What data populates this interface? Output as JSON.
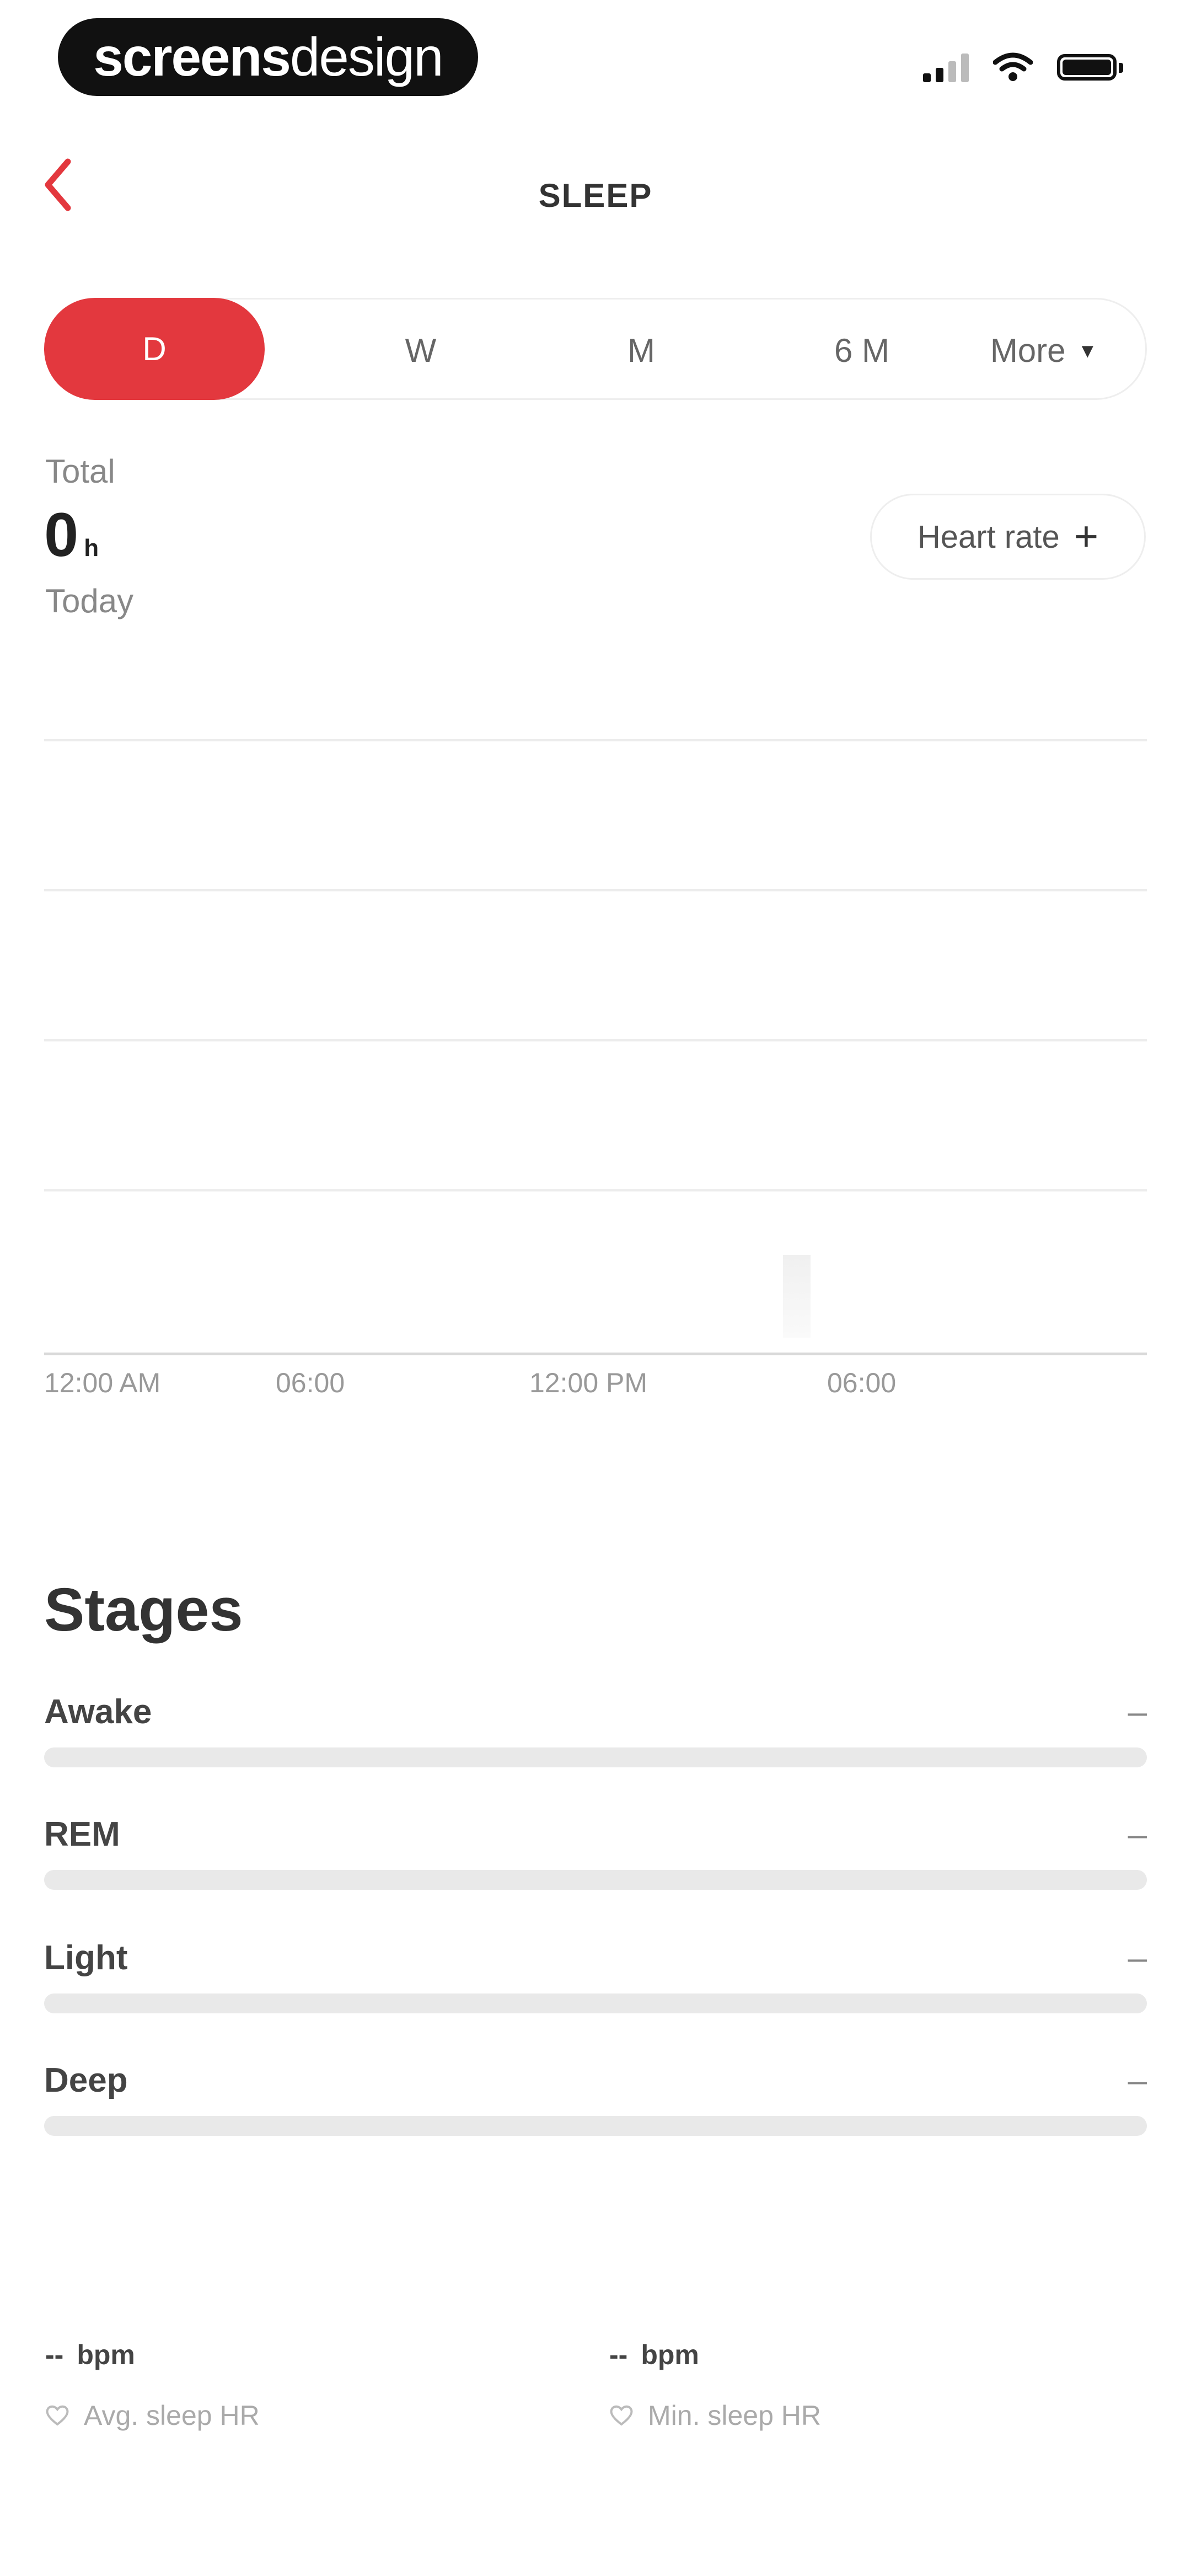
{
  "status_bar": {
    "brand_part1": "screens",
    "brand_part2": "design"
  },
  "header": {
    "title": "SLEEP"
  },
  "range_tabs": {
    "items": [
      "D",
      "W",
      "M",
      "6 M",
      "More"
    ],
    "selected": "D"
  },
  "summary": {
    "total_label": "Total",
    "total_value": "0",
    "total_unit": "h",
    "period_label": "Today",
    "heart_rate_button": "Heart rate"
  },
  "chart_data": {
    "type": "bar",
    "x_ticks": [
      "12:00 AM",
      "06:00",
      "12:00 PM",
      "06:00"
    ],
    "values": [],
    "grid": true
  },
  "stages": {
    "title": "Stages",
    "items": [
      {
        "name": "Awake",
        "value": "–"
      },
      {
        "name": "REM",
        "value": "–"
      },
      {
        "name": "Light",
        "value": "–"
      },
      {
        "name": "Deep",
        "value": "–"
      }
    ]
  },
  "heart_rate_stats": [
    {
      "value": "--",
      "unit": "bpm",
      "label": "Avg. sleep HR"
    },
    {
      "value": "--",
      "unit": "bpm",
      "label": "Min. sleep HR"
    }
  ],
  "colors": {
    "accent": "#e3383e",
    "text": "#222222",
    "muted": "#888888",
    "track": "#e9e9e9"
  }
}
